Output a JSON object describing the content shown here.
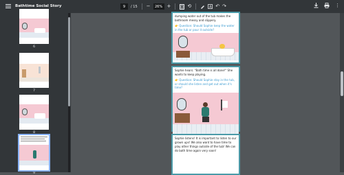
{
  "toolbar": {
    "title": "Bathtime Social Story",
    "page_current": "9",
    "page_total": "/ 15",
    "zoom": "26%",
    "icons": [
      "menu-icon",
      "zoom-out-icon",
      "zoom-in-icon",
      "fit-page-icon",
      "rotate-icon",
      "annotate-icon",
      "text-icon",
      "undo-icon",
      "redo-icon",
      "download-icon",
      "print-icon",
      "more-icon"
    ]
  },
  "sidebar": {
    "thumbnails": [
      {
        "label": "6"
      },
      {
        "label": "7"
      },
      {
        "label": "8"
      },
      {
        "label": "9"
      }
    ]
  },
  "page": {
    "card1": {
      "text": "dumping water out of the tub makes the bathroom messy and slippery.",
      "question": "👉 Question: Should Sophie keep the water in the tub or pour it outside?"
    },
    "card2": {
      "text": "Sophie hears: \"Bath time is all done!\" She wants to keep playing.",
      "question": "👉 Question: Should Sophie stay in the tub, or should she listen and get out when it's time?"
    },
    "card3": {
      "text": "Sophie listens! It is important to listen to our grown ups! We also want to have time to play other things outside of the tub! We can do bath time again very soon!"
    }
  },
  "colors": {
    "toolbar_bg": "#323639",
    "viewer_bg": "#525659",
    "card_border": "#4a9aa8",
    "question_text": "#3a9ad0",
    "scene_pink": "#f5c9d3",
    "selected_outline": "#8ab4f8"
  }
}
